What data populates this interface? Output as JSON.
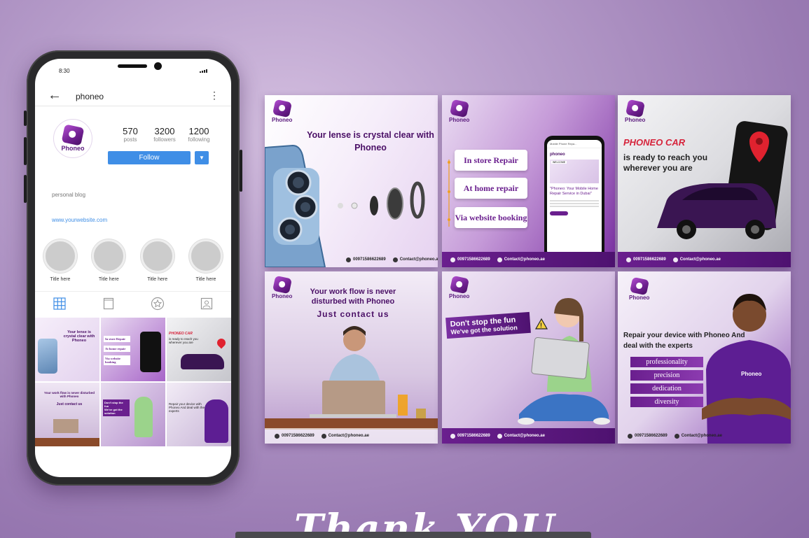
{
  "phone": {
    "time": "8:30",
    "username": "phoneo",
    "logo_text": "Phoneo",
    "stats": [
      {
        "num": "570",
        "label": "posts"
      },
      {
        "num": "3200",
        "label": "followers"
      },
      {
        "num": "1200",
        "label": "following"
      }
    ],
    "follow_label": "Follow",
    "bio": "personal blog",
    "website": "www.yourwebsite.com",
    "highlights": [
      "Title here",
      "Title here",
      "Title here",
      "Title here"
    ],
    "tab_icons": [
      "grid-icon",
      "feed-icon",
      "star-icon",
      "tagged-icon"
    ],
    "thumbs": {
      "t1": "Your lense is crystal clear with Phoneo",
      "t2": [
        "In store Repair",
        "At home repair",
        "Via website booking"
      ],
      "t3": [
        "PHONEO CAR",
        "is ready to reach you wherever you are"
      ],
      "t4": [
        "Your work flow is never disturbed with Phoneo",
        "Just contact us"
      ],
      "t5": [
        "Don't stop the fun",
        "We've got the solution"
      ],
      "t6": "Repair your device with Phoneo And deal with the experts"
    }
  },
  "brand": {
    "name": "Phoneo",
    "phone": "00971586622689",
    "email": "Contact@phoneo.ae",
    "accent": "#6a1f8e"
  },
  "posts": {
    "p1": {
      "headline": "Your lense is crystal clear with Phoneo"
    },
    "p2": {
      "services": [
        "In store Repair",
        "At home repair",
        "Via website booking"
      ],
      "screen_title": "\"Phoneo: Your Mobile Home Repair Service in Dubai\"",
      "screen_logo": "phoneo",
      "screen_welcome": "WELCOME",
      "screen_url": "Mobile Phone Repa..."
    },
    "p3": {
      "title": "PHONEO CAR",
      "subtitle": "is ready to reach you wherever you are"
    },
    "p4": {
      "headline": "Your work flow is never disturbed with Phoneo",
      "cta": "Just contact us"
    },
    "p5": {
      "title": "Don't stop the fun",
      "subtitle": "We've got the solution"
    },
    "p6": {
      "headline": "Repair your device with Phoneo And deal with the experts",
      "skills": [
        "professionality",
        "precision",
        "dedication",
        "diversity"
      ],
      "shirt": "Phoneo"
    }
  },
  "footer_text": "Thank YOU"
}
